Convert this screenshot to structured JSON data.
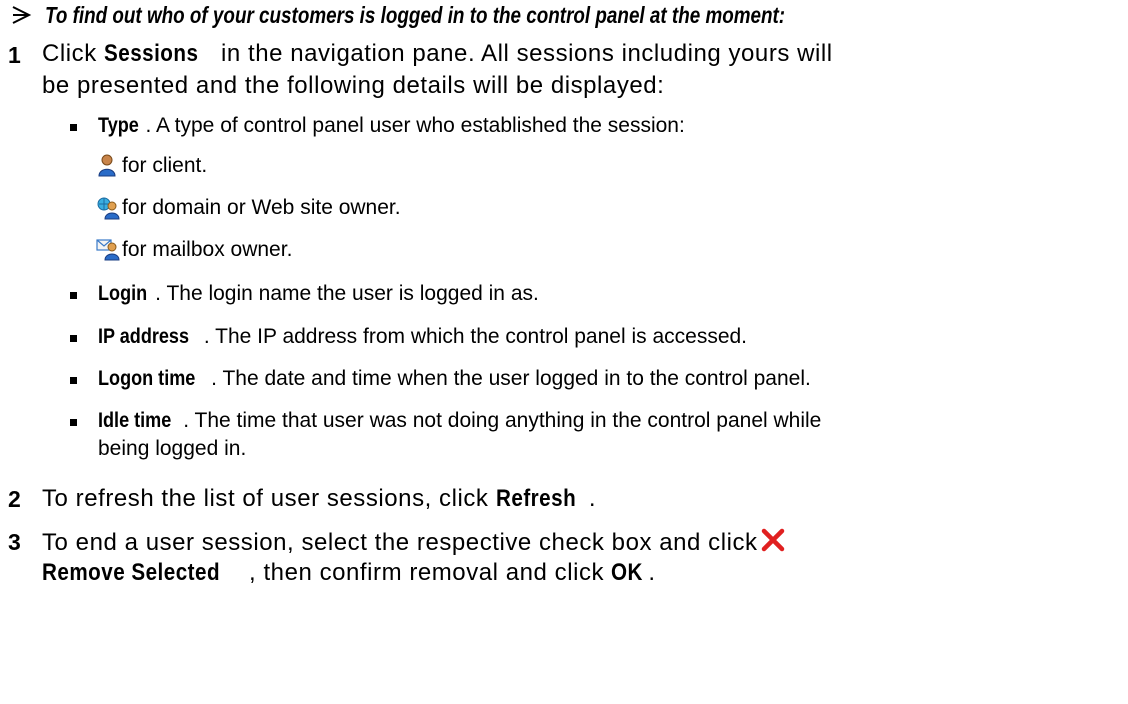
{
  "procedure_title": "To find out who of your customers is logged in to the control panel at the moment:",
  "steps": [
    {
      "number": "1",
      "line1_prefix": "Click ",
      "line1_bold": "Sessions",
      "line1_suffix": " in the navigation pane. All sessions including yours will",
      "line2": "be presented and the following details will be displayed:"
    },
    {
      "number": "2",
      "prefix": "To refresh the list of user sessions, click ",
      "bold": "Refresh",
      "suffix": "."
    },
    {
      "number": "3",
      "line1": "To end a user session, select the respective check box and click",
      "line2_bold1": "Remove Selected",
      "line2_mid": ", then confirm removal and click ",
      "line2_bold2": "OK",
      "line2_end": "."
    }
  ],
  "details": [
    {
      "term": "Type",
      "text": ". A type of control panel user who established the session:"
    },
    {
      "term": "Login",
      "text": ". The login name the user is logged in as."
    },
    {
      "term": "IP address",
      "text": ". The IP address from which the control panel is accessed."
    },
    {
      "term": "Logon time",
      "text": ". The date and time when the user logged in to the control panel."
    },
    {
      "term": "Idle time",
      "text": ". The time that user was not doing anything in the control panel while",
      "text2": "being logged in."
    }
  ],
  "user_types": [
    {
      "icon": "client-user-icon",
      "label": "for client."
    },
    {
      "icon": "domain-owner-icon",
      "label": "for domain or Web site owner."
    },
    {
      "icon": "mailbox-owner-icon",
      "label": "for mailbox owner."
    }
  ],
  "colors": {
    "text": "#000000",
    "remove_icon": "#e02020"
  }
}
